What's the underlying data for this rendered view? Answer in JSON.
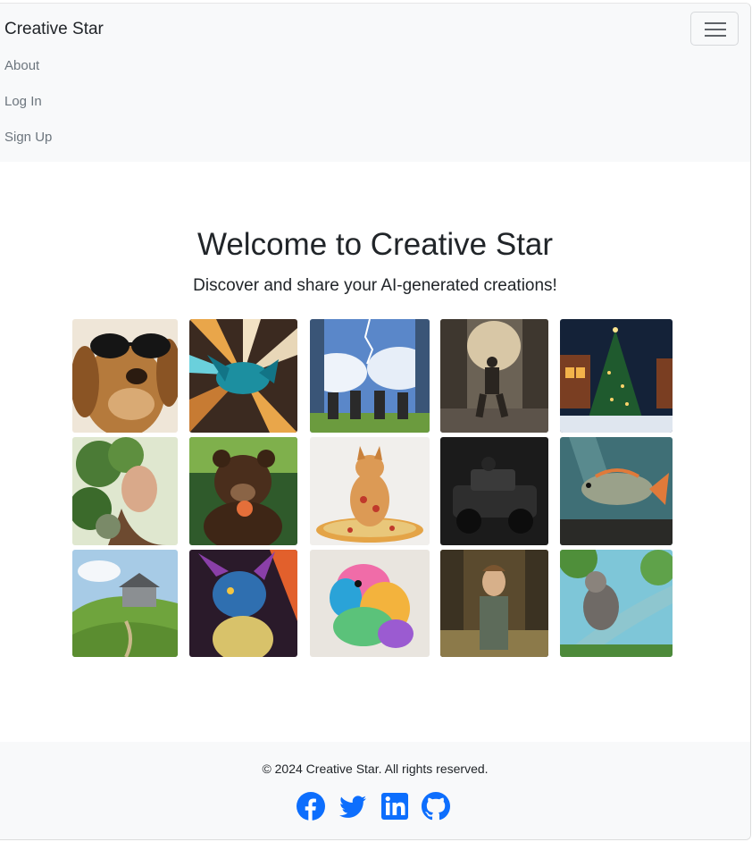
{
  "navbar": {
    "brand": "Creative Star",
    "links": [
      "About",
      "Log In",
      "Sign Up"
    ],
    "toggler_icon": "hamburger-menu-icon"
  },
  "hero": {
    "title": "Welcome to Creative Star",
    "subtitle": "Discover and share your AI-generated creations!"
  },
  "gallery": [
    "dog-with-sunglasses",
    "blue-dragon-speed",
    "horse-riders-clouds",
    "man-running-ruined-street",
    "christmas-tree-night",
    "mechanical-plant-woman",
    "bear-eating",
    "cat-on-pizza",
    "dark-armored-vehicle",
    "fish-underwater",
    "house-on-green-hill",
    "colorful-dragon",
    "rainbow-dog",
    "boy-rainy-street",
    "monkey-on-tree"
  ],
  "footer": {
    "copyright": "© 2024 Creative Star. All rights reserved.",
    "social": [
      "facebook-icon",
      "twitter-icon",
      "linkedin-icon",
      "github-icon"
    ]
  },
  "colors": {
    "navbar_bg": "#f8f9fa",
    "footer_bg": "#f8f9fa",
    "social_blue": "#0d6efd",
    "text": "#212529",
    "muted": "#6c757d"
  }
}
